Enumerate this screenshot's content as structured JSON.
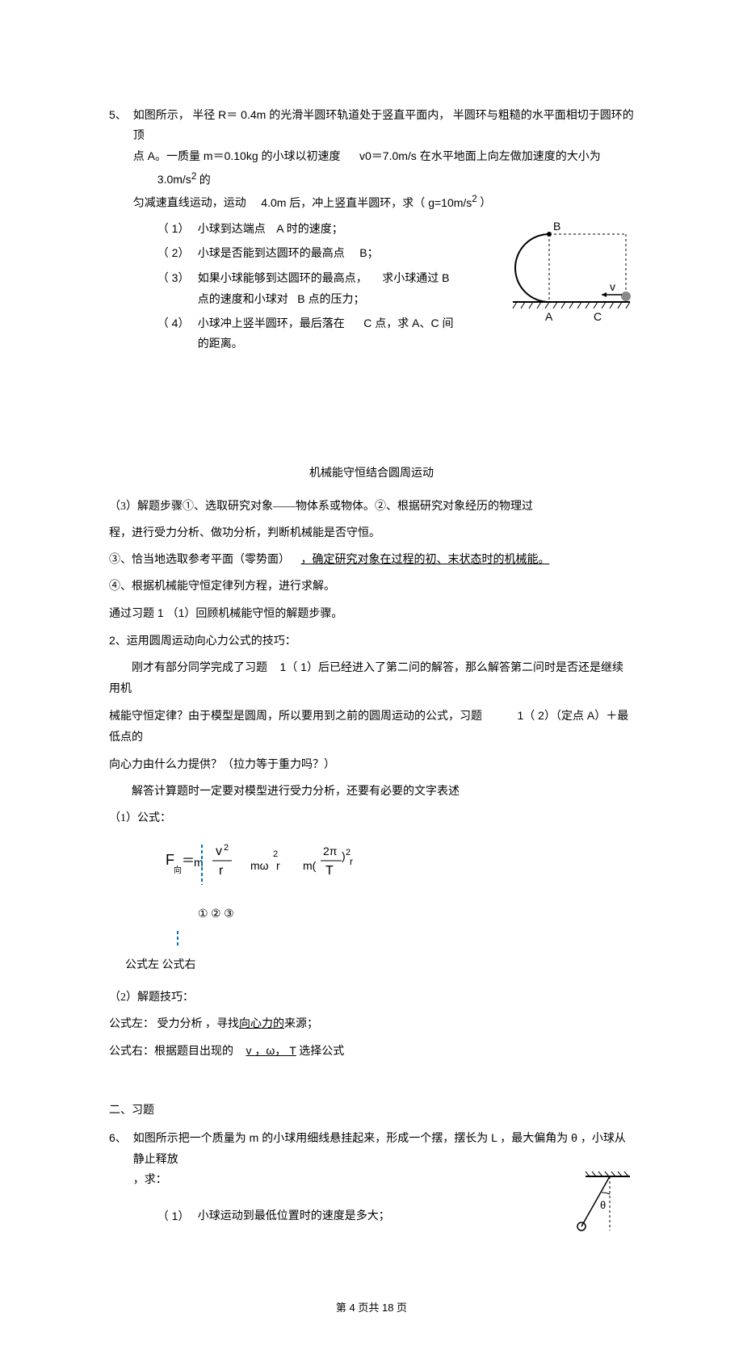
{
  "q5": {
    "num": "5、",
    "intro1": "如图所示，",
    "intro2": "半径 R＝ 0.4m 的光滑半圆环轨道处于竖直平面内，",
    "intro3": "半圆环与粗糙的水平面相切于圆环的顶",
    "line2a": "点 A。一质量  m＝0.10kg 的小球以初速度",
    "line2b": "v0＝7.0m/s 在水平地面上向左做加速度的大小为",
    "line2c": "3.0m/s",
    "line2d": " 的",
    "line3": "匀减速直线运动，运动",
    "line3b": "4.0m 后，冲上竖直半圆环，求（  g=10m/s",
    "line3c": " ）",
    "sub1n": "（ 1）",
    "sub1": "小球到达端点",
    "sub1b": "A 时的速度；",
    "sub2n": "（ 2）",
    "sub2": "小球是否能到达圆环的最高点",
    "sub2b": "B；",
    "sub3n": "（ 3）",
    "sub3": "如果小球能够到达圆环的最高点，",
    "sub3b": "求小球通过 B",
    "sub3c": "点的速度和小球对",
    "sub3d": "B 点的压力；",
    "sub4n": "（ 4）",
    "sub4": "小球冲上竖半圆环，最后落在",
    "sub4b": "C 点，求 A、C 间",
    "sub4c": "的距离。",
    "labelA": "A",
    "labelB": "B",
    "labelC": "C",
    "labelV": "v"
  },
  "section_title": "机械能守恒结合圆周运动",
  "p1": "（3）解题步骤①、选取研究对象——物体系或物体。②、根据研究对象经历的物理过",
  "p2": "程，进行受力分析、做功分析，判断机械能是否守恒。",
  "p3a": "③、恰当地选取参考平面（零势面）",
  "p3b": "，确定研究对象在过程的初",
  "p3u": "、末状态时的机械能。",
  "p4": "④、根据机械能守恒定律列方程，进行求解。",
  "p5": "通过习题 1 （1）回顾机械能守恒的解题步骤。",
  "p6": "2、运用圆周运动向心力公式的技巧：",
  "p7a": "刚才有部分同学完成了习题",
  "p7b": "1（ 1）后已经进入了第二问的解答，那么解答第二问时是否还是继续用机",
  "p8a": "械能守恒定律？由于模型是圆周，所以要用到之前的圆周运动的公式，习题",
  "p8b": "1（ 2）（定点 A）＋最低点的",
  "p9": "向心力由什么力提供？（拉力等于重力吗？）",
  "p10": "解答计算题时一定要对模型进行受力分析，还要有必要的文字表述",
  "p11": "（1）公式：",
  "formula_labels": "①        ②               ③",
  "formula_bottom": "公式左     公式右",
  "p12": "（2）解题技巧：",
  "p13a": "公式左：  受力分析  ，寻找",
  "p13u": "向心力的",
  "p13b": "来源；",
  "p14a": "公式右：根据题目出现的",
  "p14u": "v ，ω，  T",
  "p14b": " 选择公式",
  "section2": "二、习题",
  "q6": {
    "num": "6、",
    "text": "如图所示把一个质量为 m 的小球用细线悬挂起来，形成一个摆，摆长为 L ，最大偏角为  θ  ，小球从静止释放",
    "text2": "，求：",
    "sub1n": "（ 1）",
    "sub1": "小球运动到最低位置时的速度是多大；",
    "theta": "θ"
  },
  "footer": "第 4 页共 18 页"
}
